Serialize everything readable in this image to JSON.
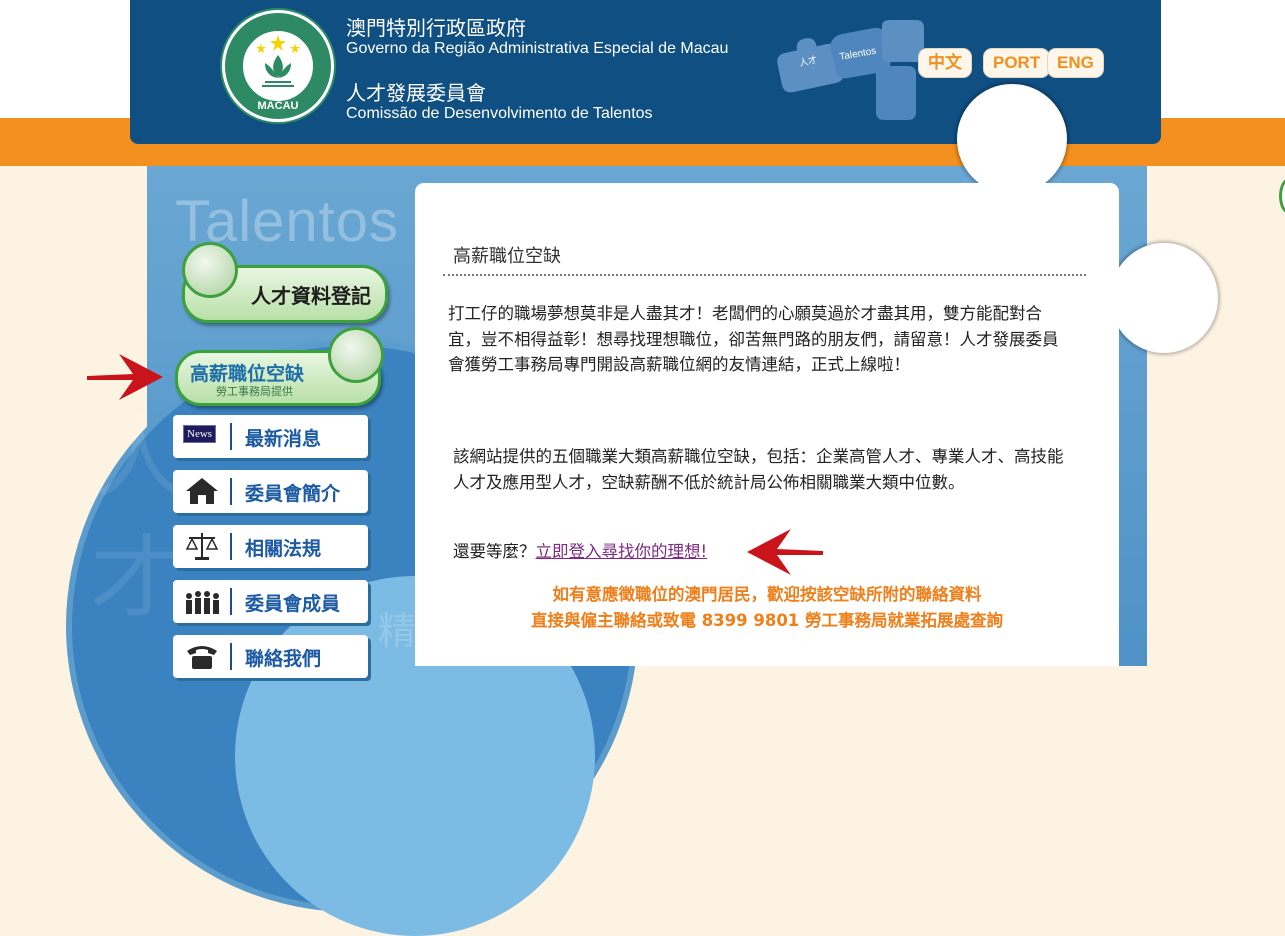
{
  "header": {
    "gov_zh": "澳門特別行政區政府",
    "gov_pt": "Governo da Região Administrativa Especial de Macau",
    "commission_zh": "人才發展委員會",
    "commission_pt": "Comissão de Desenvolvimento de Talentos",
    "emblem_text": "MACAU",
    "puzzle_labels": [
      "人才",
      "Talentos"
    ]
  },
  "languages": [
    "中文",
    "PORT",
    "ENG"
  ],
  "sidebar": {
    "watermark": "Talentos",
    "watermark_zh": [
      "人",
      "才",
      "精"
    ],
    "talent_registration": "人才資料登記",
    "high_salary_jobs": {
      "label": "高薪職位空缺",
      "sub": "勞工事務局提供"
    },
    "nav": [
      {
        "label": "最新消息",
        "icon": "news-icon",
        "badge": "News"
      },
      {
        "label": "委員會簡介",
        "icon": "home-icon"
      },
      {
        "label": "相關法規",
        "icon": "scales-icon"
      },
      {
        "label": "委員會成員",
        "icon": "people-icon"
      },
      {
        "label": "聯絡我們",
        "icon": "phone-icon"
      }
    ]
  },
  "content": {
    "title": "高薪職位空缺",
    "paragraph1": "打工仔的職場夢想莫非是人盡其才！老闆們的心願莫過於才盡其用，雙方能配對合宜，豈不相得益彰！想尋找理想職位，卻苦無門路的朋友們，請留意！人才發展委員會獲勞工事務局專門開設高薪職位網的友情連結，正式上線啦！",
    "paragraph2": "該網站提供的五個職業大類高薪職位空缺，包括：企業高管人才、專業人才、高技能人才及應用型人才，空缺薪酬不低於統計局公佈相關職業大類中位數。",
    "prompt": "還要等麼？",
    "link": "立即登入尋找你的理想!",
    "notice1": "如有意應徵職位的澳門居民，歡迎按該空缺所附的聯絡資料",
    "notice2": "直接與僱主聯絡或致電 8399 9801 勞工事務局就業拓展處查詢"
  },
  "colors": {
    "header_blue": "#0f4f82",
    "orange": "#f3901f",
    "accent_orange_text": "#ef7f1a",
    "link_purple": "#7d2b83",
    "arrow_red": "#c8141a",
    "nav_blue_text": "#1c5aa3"
  }
}
